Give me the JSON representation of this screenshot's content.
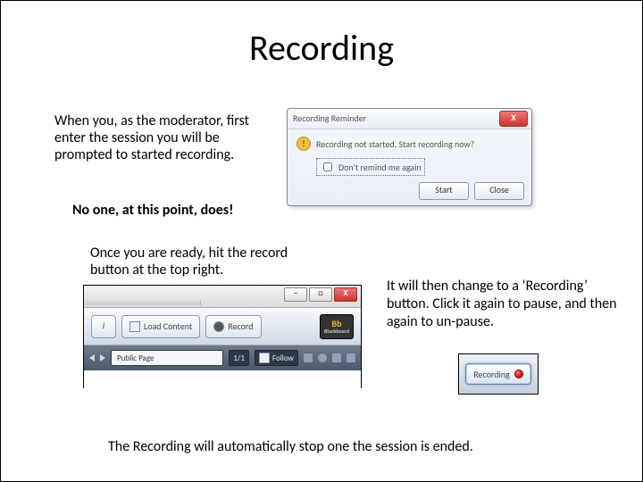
{
  "title": "Recording",
  "intro": "When you, as the moderator, first enter the session you will be prompted to started recording.",
  "bold_note": "No one, at this point, does!",
  "once_ready": "Once you are ready, hit the record button at the top right.",
  "change_text": "It will then change to a ‘Recording’ button.  Click it again to pause, and then again to un-pause.",
  "autostop": "The Recording will automatically stop one the session is ended.",
  "dialog": {
    "title": "Recording Reminder",
    "close_x": "X",
    "icon_glyph": "!",
    "message": "Recording not started. Start recording now?",
    "checkbox_label": "Don't remind me again",
    "start_label": "Start",
    "close_label": "Close"
  },
  "toolbar": {
    "win_min": "–",
    "win_max": "□",
    "win_close": "X",
    "info_glyph": "i",
    "load_content_label": "Load Content",
    "record_label": "Record",
    "logo_main": "Bb",
    "logo_sub": "Blackboard",
    "page_label": "Public Page",
    "counter": "1/1",
    "follow_label": "Follow"
  },
  "recording_button": {
    "label": "Recording"
  }
}
